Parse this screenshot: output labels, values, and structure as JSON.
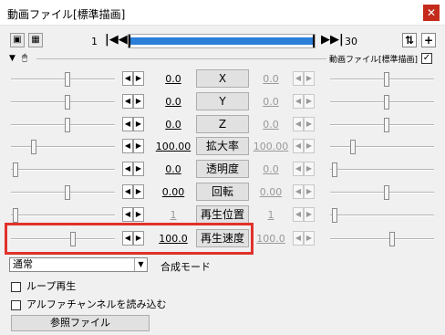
{
  "window": {
    "title": "動画ファイル[標準描画]",
    "close_label": "✕"
  },
  "toolbar": {
    "frame_start": "1",
    "frame_end": "30",
    "progress": 1.0
  },
  "section": {
    "label": "動画ファイル[標準描画]",
    "enabled": true
  },
  "tracks": [
    {
      "name": "X",
      "value": "0.0",
      "end_value": "0.0",
      "left_level": 0.55,
      "right_level": 0.55,
      "dim_left": false
    },
    {
      "name": "Y",
      "value": "0.0",
      "end_value": "0.0",
      "left_level": 0.55,
      "right_level": 0.55,
      "dim_left": false
    },
    {
      "name": "Z",
      "value": "0.0",
      "end_value": "0.0",
      "left_level": 0.55,
      "right_level": 0.55,
      "dim_left": false
    },
    {
      "name": "拡大率",
      "value": "100.00",
      "end_value": "100.00",
      "left_level": 0.2,
      "right_level": 0.2,
      "dim_left": false
    },
    {
      "name": "透明度",
      "value": "0.0",
      "end_value": "0.0",
      "left_level": 0.02,
      "right_level": 0.02,
      "dim_left": false
    },
    {
      "name": "回転",
      "value": "0.00",
      "end_value": "0.00",
      "left_level": 0.55,
      "right_level": 0.55,
      "dim_left": false
    },
    {
      "name": "再生位置",
      "value": "1",
      "end_value": "1",
      "left_level": 0.02,
      "right_level": 0.02,
      "dim_left": true
    },
    {
      "name": "再生速度",
      "value": "100.0",
      "end_value": "100.0",
      "left_level": 0.6,
      "right_level": 0.6,
      "dim_left": false
    }
  ],
  "blend": {
    "value": "通常",
    "label": "合成モード"
  },
  "options": [
    {
      "label": "ループ再生",
      "checked": false
    },
    {
      "label": "アルファチャンネルを読み込む",
      "checked": false
    }
  ],
  "reference_button": "参照ファイル",
  "colors": {
    "accent": "#2b7fd8",
    "highlight": "#e0312b"
  }
}
